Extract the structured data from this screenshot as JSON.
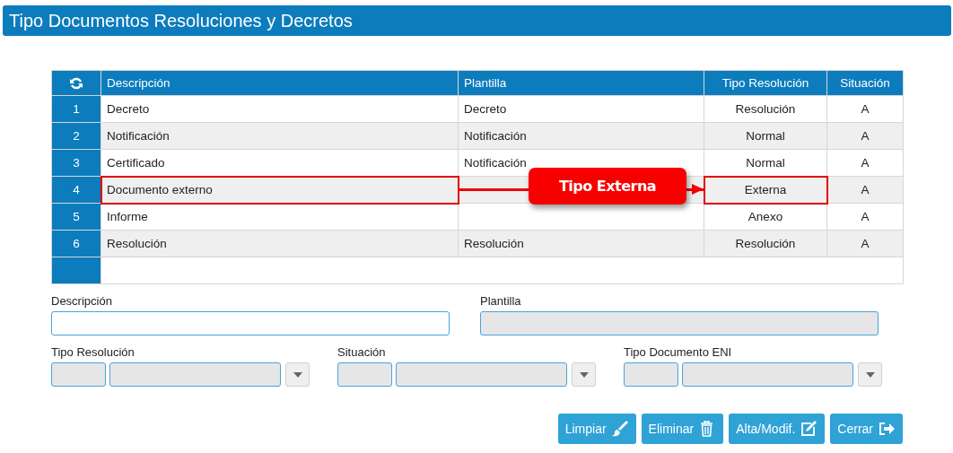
{
  "window": {
    "title": "Tipo Documentos Resoluciones y Decretos"
  },
  "table": {
    "columns": [
      {
        "label": "Descripción"
      },
      {
        "label": "Plantilla"
      },
      {
        "label": "Tipo Resolución"
      },
      {
        "label": "Situación"
      }
    ],
    "rows": [
      {
        "number": "1",
        "cells": [
          "Decreto",
          "Decreto",
          "Resolución",
          "A"
        ],
        "marked": false
      },
      {
        "number": "2",
        "cells": [
          "Notificación",
          "Notificación",
          "Normal",
          "A"
        ],
        "marked": false
      },
      {
        "number": "3",
        "cells": [
          "Certificado",
          "Notificación",
          "Normal",
          "A"
        ],
        "marked": false
      },
      {
        "number": "4",
        "cells": [
          "Documento externo",
          "",
          "Externa",
          "A"
        ],
        "marked": true
      },
      {
        "number": "5",
        "cells": [
          "Informe",
          "",
          "Anexo",
          "A"
        ],
        "marked": false
      },
      {
        "number": "6",
        "cells": [
          "Resolución",
          "Resolución",
          "Resolución",
          "A"
        ],
        "marked": false
      }
    ]
  },
  "annotation": {
    "label": "Tipo Externa"
  },
  "form": {
    "text_fields": [
      {
        "label": "Descripción",
        "disabled": false
      },
      {
        "label": "Plantilla",
        "disabled": true
      }
    ],
    "selects": [
      {
        "label": "Tipo Resolución"
      },
      {
        "label": "Situación"
      },
      {
        "label": "Tipo Documento ENI"
      }
    ]
  },
  "buttons": [
    {
      "label": "Limpiar"
    },
    {
      "label": "Eliminar"
    },
    {
      "label": "Alta/Modif."
    },
    {
      "label": "Cerrar"
    }
  ]
}
